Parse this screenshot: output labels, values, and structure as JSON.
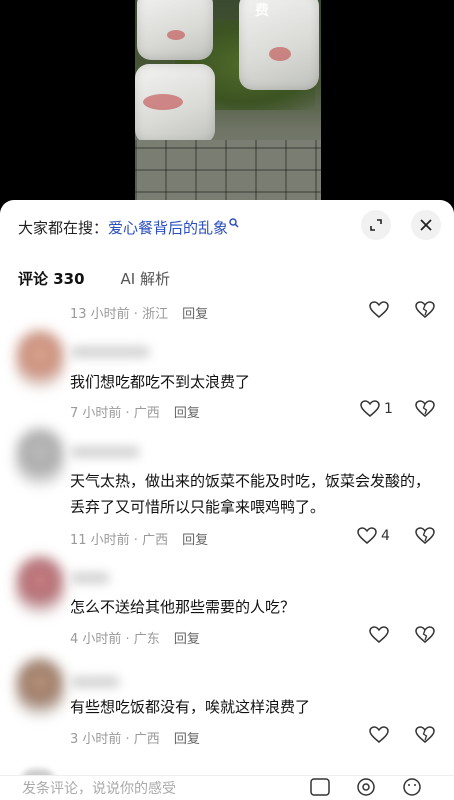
{
  "video": {
    "overlay_text": "费"
  },
  "search": {
    "prefix": "大家都在搜：",
    "term": "爱心餐背后的乱象"
  },
  "tabs": [
    {
      "label": "评论 330"
    },
    {
      "label": "AI 解析"
    }
  ],
  "comments": [
    {
      "text": "",
      "time": "13 小时前 · 浙江",
      "reply": "回复",
      "likes": ""
    },
    {
      "text": "我们想吃都吃不到太浪费了",
      "time": "7 小时前 · 广西",
      "reply": "回复",
      "likes": "1"
    },
    {
      "text": "天气太热，做出来的饭菜不能及时吃，饭菜会发酸的，丢弃了又可惜所以只能拿来喂鸡鸭了。",
      "time": "11 小时前 · 广西",
      "reply": "回复",
      "likes": "4"
    },
    {
      "text": "怎么不送给其他那些需要的人吃？",
      "time": "4 小时前 · 广东",
      "reply": "回复",
      "likes": ""
    },
    {
      "text": "有些想吃饭都没有，唉就这样浪费了",
      "time": "3 小时前 · 广西",
      "reply": "回复",
      "likes": ""
    }
  ],
  "bottom": {
    "placeholder": "发条评论，说说你的感受"
  },
  "icons": {
    "heart": "heart-icon",
    "broken_heart": "broken-heart-icon",
    "search": "search-icon",
    "expand": "expand-icon",
    "close": "close-icon"
  },
  "colors": {
    "link_blue": "#2a4fbf",
    "meta_gray": "#9a9a9a"
  }
}
